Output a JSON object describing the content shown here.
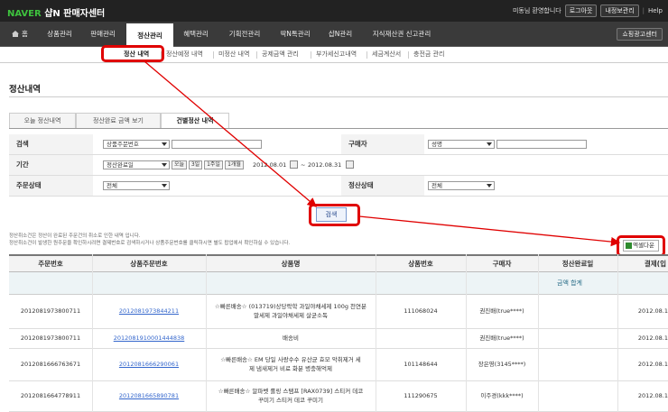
{
  "header": {
    "brand_naver": "NAVER",
    "brand_title": "샵N 판매자센터",
    "welcome": "미동님 환영합니다",
    "logout": "로그아웃",
    "my_info": "내정보관리",
    "help": "Help"
  },
  "gnb": {
    "home": "홈",
    "items": [
      "상품관리",
      "판매관리",
      "정산관리",
      "혜택관리",
      "기획전관리",
      "딱N톡관리",
      "샵N관리",
      "지식재산권 신고관리"
    ],
    "active_index": 2,
    "right": "쇼핑광고센터"
  },
  "lnb": {
    "items": [
      "정산 내역",
      "정산예정 내역",
      "미정산 내역",
      "공제금액 관리",
      "부가세신고내역",
      "세금계산서",
      "충전금 관리"
    ],
    "active_index": 0
  },
  "page": {
    "title": "정산내역"
  },
  "tabs": {
    "items": [
      "오늘 정산내역",
      "정산완료 금액 보기",
      "건별정산 내역"
    ],
    "active_index": 2
  },
  "filters": {
    "search_label": "검색",
    "search_select": "상품주문번호",
    "buyer_label": "구매자",
    "buyer_select": "성명",
    "period_label": "기간",
    "period_select": "정산완료일",
    "period_buttons": [
      "오늘",
      "3일",
      "1주일",
      "1개월"
    ],
    "date_from": "2012.08.01",
    "date_sep": "~",
    "date_to": "2012.08.31",
    "order_status_label": "주문상태",
    "order_status_select": "전체",
    "settle_status_label": "정산상태",
    "settle_status_select": "전체",
    "search_button": "검색"
  },
  "notes": {
    "line1": "정산취소건은 정산이 완료된 주문건의 취소로 인한 내역 입니다.",
    "line2": "정산취소건이 발생한 원주문을 확인하시려면 결제번호로 검색하시거나 상품주문번호를 클릭하시면 별도 팝업에서 확인하실 수 있습니다."
  },
  "excel_button": "엑셀다운",
  "table": {
    "headers": [
      "주문번호",
      "상품주문번호",
      "상품명",
      "상품번호",
      "구매자",
      "정산완료일",
      "결제(입"
    ],
    "summary_label": "금액 합계",
    "rows": [
      {
        "order_no": "2012081973800711",
        "product_order_no": "2012081973844211",
        "product_name_1": "☆빠른배송☆ (013719)상당락학 과일야채세제 100g 천연분",
        "product_name_2": "말세제 과일야채세제 살균소독",
        "product_no": "111068024",
        "buyer": "권진배(true****)",
        "date": "2012.08.1"
      },
      {
        "order_no": "2012081973800711",
        "product_order_no": "2012081910001444838",
        "product_name_1": "배송비",
        "product_name_2": "",
        "product_no": "",
        "buyer": "권진배(true****)",
        "date": "2012.08.1"
      },
      {
        "order_no": "2012081666763671",
        "product_order_no": "2012081666290061",
        "product_name_1": "☆빠른배송☆ EM 당일 사랑수수 유산균 효모 악취제거 세",
        "product_name_2": "제 냄새제거 비료 화분 병충해억제",
        "product_no": "101148644",
        "buyer": "장은영(3145****)",
        "date": "2012.08.1"
      },
      {
        "order_no": "2012081664778911",
        "product_order_no": "2012081665890781",
        "product_name_1": "☆빠른배송☆ 알파벳 롤링 스탬프 [RAX0739] 스티커 데코",
        "product_name_2": "꾸미기 스티커 데코 꾸미기",
        "product_no": "111290675",
        "buyer": "이주경(kkk****)",
        "date": "2012.08.1"
      }
    ]
  },
  "colors": {
    "highlight": "#e00000",
    "topbar": "#222222",
    "gnb": "#3a3a3a",
    "naver_green": "#3ec33e",
    "link": "#3366cc"
  }
}
